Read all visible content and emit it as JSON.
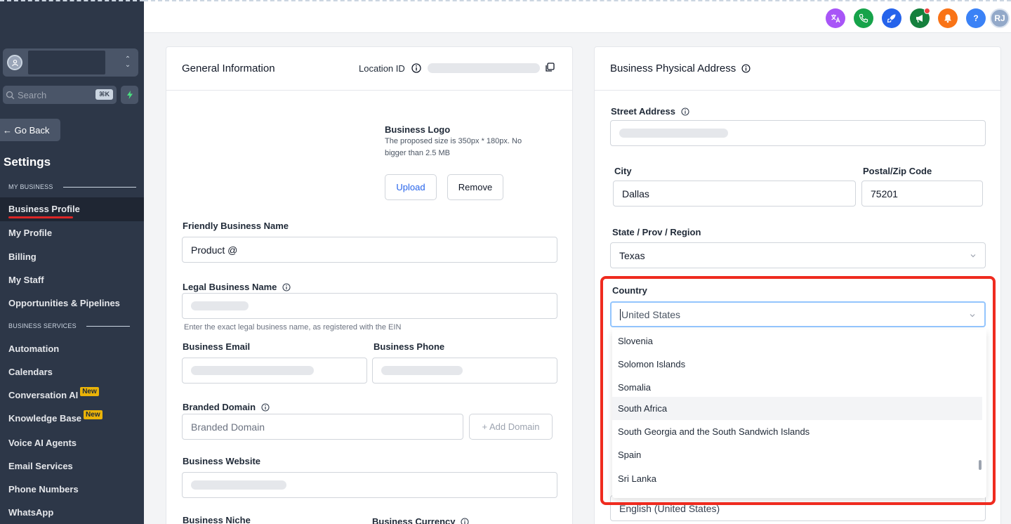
{
  "sidebar": {
    "search_placeholder": "Search",
    "search_kbd": "⌘K",
    "go_back": "← Go Back",
    "settings_title": "Settings",
    "section_my_business": "MY BUSINESS",
    "section_business_services": "BUSINESS SERVICES",
    "items": [
      {
        "label": "Business Profile",
        "active": true
      },
      {
        "label": "My Profile"
      },
      {
        "label": "Billing"
      },
      {
        "label": "My Staff"
      },
      {
        "label": "Opportunities & Pipelines"
      },
      {
        "label": "Automation"
      },
      {
        "label": "Calendars"
      },
      {
        "label": "Conversation AI",
        "badge": "New"
      },
      {
        "label": "Knowledge Base",
        "badge": "New"
      },
      {
        "label": "Voice AI Agents"
      },
      {
        "label": "Email Services"
      },
      {
        "label": "Phone Numbers"
      },
      {
        "label": "WhatsApp"
      }
    ]
  },
  "topbar": {
    "avatar_initials": "RJ",
    "help_label": "?",
    "colors": {
      "translate": "#a855f7",
      "phone": "#16a34a",
      "rocket": "#2563eb",
      "megaphone": "#15803d",
      "bell": "#f97316",
      "help": "#3b82f6",
      "avatar": "#93a9c9"
    }
  },
  "general": {
    "title": "General Information",
    "location_id_label": "Location ID",
    "logo_title": "Business Logo",
    "logo_help_1": "The proposed size is 350px * 180px. No",
    "logo_help_2": "bigger than 2.5 MB",
    "upload": "Upload",
    "remove": "Remove",
    "friendly_name_label": "Friendly Business Name",
    "friendly_name_value": "Product @",
    "legal_name_label": "Legal Business Name",
    "legal_name_help": "Enter the exact legal business name, as registered with the EIN",
    "email_label": "Business Email",
    "phone_label": "Business Phone",
    "domain_label": "Branded Domain",
    "domain_placeholder": "Branded Domain",
    "add_domain": "+ Add Domain",
    "website_label": "Business Website",
    "niche_label": "Business Niche",
    "currency_label": "Business Currency"
  },
  "address": {
    "title": "Business Physical Address",
    "street_label": "Street Address",
    "city_label": "City",
    "city_value": "Dallas",
    "zip_label": "Postal/Zip Code",
    "zip_value": "75201",
    "state_label": "State / Prov / Region",
    "state_value": "Texas",
    "country_label": "Country",
    "country_value": "United States",
    "language_value": "English (United States)",
    "country_options": [
      {
        "label": "Slovenia"
      },
      {
        "label": "Solomon Islands"
      },
      {
        "label": "Somalia"
      },
      {
        "label": "South Africa",
        "hovered": true
      },
      {
        "label": "South Georgia and the South Sandwich Islands"
      },
      {
        "label": "Spain"
      },
      {
        "label": "Sri Lanka"
      }
    ]
  }
}
